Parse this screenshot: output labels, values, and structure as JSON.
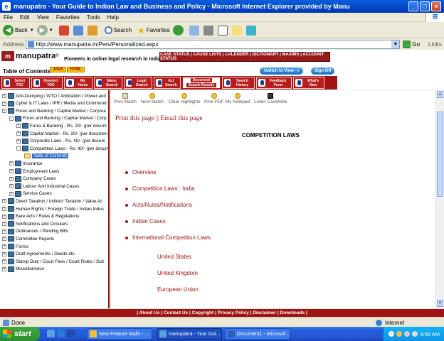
{
  "window": {
    "title": "manupatra - Your Guide to Indian Law and Business and Policy - Microsoft Internet Explorer provided by Manu"
  },
  "menu": [
    "File",
    "Edit",
    "View",
    "Favorites",
    "Tools",
    "Help"
  ],
  "toolbar": {
    "back": "Back",
    "search": "Search",
    "favorites": "Favorites"
  },
  "address": {
    "label": "Address",
    "url": "http://www.manupatra.in/Pers/Personalized.aspx",
    "go": "Go",
    "links": "Links"
  },
  "site": {
    "logo": "manupatra",
    "logo_mark": "m",
    "reg": "®",
    "tagline": "Pioneers in online legal research in India",
    "topnav": "CASE STATUS | CAUSE LISTS | CALENDER | DICTIONARY | MAXIMS | ACCOUNT STATUS",
    "switch_view": "Switch to View - I",
    "sign_off": "Sign Off"
  },
  "toc": {
    "title": "Table of Contents",
    "java": "JAVA",
    "html": "HTML"
  },
  "rednav": [
    {
      "label": "Select TOC"
    },
    {
      "label": "Deselect TOC"
    },
    {
      "label": "My Home"
    },
    {
      "label": "Manu Search"
    },
    {
      "label": "Legal Search"
    },
    {
      "label": "Act Search"
    },
    {
      "label1": "Document",
      "label2": "Search Results"
    },
    {
      "label": "Search History"
    },
    {
      "label": "Feedback Form"
    },
    {
      "label": "What's New"
    }
  ],
  "tree": [
    {
      "level": 0,
      "label": "Anti-Dumping / WTO / Arbitration / Power and",
      "sign": "+"
    },
    {
      "level": 0,
      "label": "Cyber & IT Laws / IPR / Media and Communic",
      "sign": "+"
    },
    {
      "level": 0,
      "label": "Forex and Banking / Capital Market / Corpora",
      "sign": "-"
    },
    {
      "level": 1,
      "label": "Forex and Banking / Capital Market / Corp",
      "sign": "-"
    },
    {
      "level": 2,
      "label": "Forex & Banking - Rs. 20/- (per docum",
      "sign": "+"
    },
    {
      "level": 2,
      "label": "Capital Market - Rs. 20/- (per documen",
      "sign": "+"
    },
    {
      "level": 2,
      "label": "Corporate Laws - Rs. 40/- (per docum",
      "sign": "+"
    },
    {
      "level": 2,
      "label": "Competition Laws - Rs. 40/- (per docum",
      "sign": "-"
    },
    {
      "level": 3,
      "label": "Table of Contents",
      "sign": ""
    },
    {
      "level": 1,
      "label": "Insurance",
      "sign": "+"
    },
    {
      "level": 1,
      "label": "Employment Laws",
      "sign": "+"
    },
    {
      "level": 1,
      "label": "Company Cases",
      "sign": "+"
    },
    {
      "level": 1,
      "label": "Labour And Industrial Cases",
      "sign": "+"
    },
    {
      "level": 1,
      "label": "Service Cases",
      "sign": "+"
    },
    {
      "level": 0,
      "label": "Direct Taxation / Indirect Taxation / Value Ac",
      "sign": "+"
    },
    {
      "level": 0,
      "label": "Human Rights / Foreign Trade / Indian Indus",
      "sign": "+"
    },
    {
      "level": 0,
      "label": "Bare Acts / Rules & Regulations",
      "sign": "+"
    },
    {
      "level": 0,
      "label": "Notifications and Circulars",
      "sign": "+"
    },
    {
      "level": 0,
      "label": "Ordinances / Pending Bills",
      "sign": "+"
    },
    {
      "level": 0,
      "label": "Committee Reports",
      "sign": "+"
    },
    {
      "level": 0,
      "label": "Forms",
      "sign": "+"
    },
    {
      "level": 0,
      "label": "Draft Agreements / Deeds etc.",
      "sign": "+"
    },
    {
      "level": 0,
      "label": "Stamp Duty / Court Fees / Court Rules / Suit",
      "sign": "+"
    },
    {
      "level": 0,
      "label": "Miscellaneous",
      "sign": "+"
    }
  ],
  "content_tools": [
    "Prev Match",
    "Next Match",
    "Clear Highlights",
    "Print PDF",
    "My Notepad",
    "Listen CaseNote"
  ],
  "print_links": {
    "print": "Print this page",
    "sep": "||",
    "email": "Email this page"
  },
  "page_heading": "COMPETITION LAWS",
  "items": [
    "Overview",
    "Competition Laws : India",
    "Acts/Rules/Notifications",
    "Indian Cases",
    "International Competition Laws"
  ],
  "sub_items": [
    "United States",
    "United Kingdom",
    "European Union"
  ],
  "footer": "| About Us | Contact Us | Copyright | Privacy Policy | Disclaimer | Downloads |",
  "status": {
    "text": "Done",
    "zone": "Internet"
  },
  "taskbar": {
    "start": "start",
    "tasks": [
      "New Feature Mails - ...",
      "manupatra - Your Gui...",
      "Document1 - Microsof..."
    ],
    "time": "9:56 AM"
  }
}
